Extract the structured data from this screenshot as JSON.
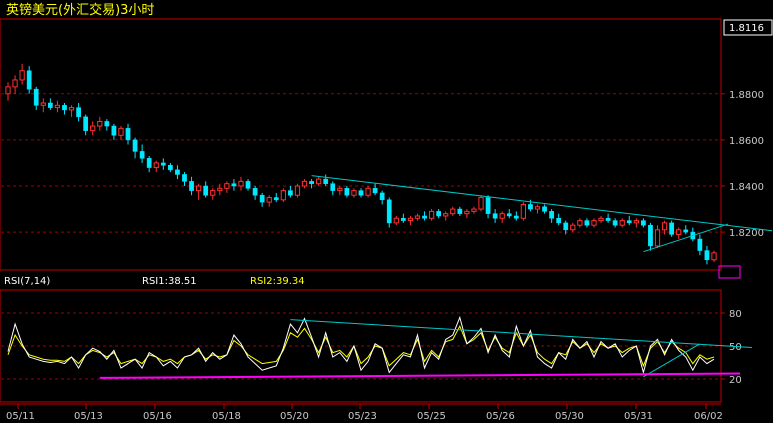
{
  "chart_data": [
    {
      "type": "candlestick",
      "title": "英镑美元(外汇交易)3小时",
      "last_price": "1.8116",
      "ylim": [
        1.804,
        1.912
      ],
      "y_ticks": [
        1.82,
        1.84,
        1.86,
        1.88
      ],
      "y_tick_labels": [
        "1.8200",
        "1.8400",
        "1.8600",
        "1.8800"
      ],
      "x_ticks": [
        "05/11",
        "05/13",
        "05/16",
        "05/18",
        "05/20",
        "05/23",
        "05/25",
        "05/26",
        "05/30",
        "05/31",
        "06/02"
      ],
      "grid": true,
      "ohlc": [
        [
          1.88,
          1.885,
          1.877,
          1.883
        ],
        [
          1.883,
          1.888,
          1.88,
          1.886
        ],
        [
          1.886,
          1.893,
          1.884,
          1.89
        ],
        [
          1.89,
          1.892,
          1.88,
          1.882
        ],
        [
          1.882,
          1.883,
          1.873,
          1.875
        ],
        [
          1.875,
          1.878,
          1.872,
          1.876
        ],
        [
          1.876,
          1.878,
          1.873,
          1.874
        ],
        [
          1.874,
          1.877,
          1.872,
          1.875
        ],
        [
          1.875,
          1.876,
          1.871,
          1.873
        ],
        [
          1.873,
          1.875,
          1.87,
          1.874
        ],
        [
          1.874,
          1.876,
          1.868,
          1.87
        ],
        [
          1.87,
          1.871,
          1.862,
          1.864
        ],
        [
          1.864,
          1.868,
          1.862,
          1.866
        ],
        [
          1.866,
          1.87,
          1.864,
          1.868
        ],
        [
          1.868,
          1.869,
          1.864,
          1.866
        ],
        [
          1.866,
          1.867,
          1.86,
          1.862
        ],
        [
          1.862,
          1.866,
          1.86,
          1.865
        ],
        [
          1.865,
          1.867,
          1.858,
          1.86
        ],
        [
          1.86,
          1.861,
          1.852,
          1.855
        ],
        [
          1.855,
          1.858,
          1.85,
          1.852
        ],
        [
          1.852,
          1.853,
          1.846,
          1.848
        ],
        [
          1.848,
          1.851,
          1.846,
          1.85
        ],
        [
          1.85,
          1.852,
          1.847,
          1.849
        ],
        [
          1.849,
          1.85,
          1.846,
          1.847
        ],
        [
          1.847,
          1.849,
          1.843,
          1.845
        ],
        [
          1.845,
          1.846,
          1.84,
          1.842
        ],
        [
          1.842,
          1.844,
          1.836,
          1.838
        ],
        [
          1.838,
          1.841,
          1.834,
          1.84
        ],
        [
          1.84,
          1.842,
          1.835,
          1.836
        ],
        [
          1.836,
          1.839,
          1.834,
          1.838
        ],
        [
          1.838,
          1.841,
          1.836,
          1.839
        ],
        [
          1.839,
          1.842,
          1.837,
          1.841
        ],
        [
          1.841,
          1.843,
          1.838,
          1.84
        ],
        [
          1.84,
          1.844,
          1.838,
          1.842
        ],
        [
          1.842,
          1.843,
          1.838,
          1.839
        ],
        [
          1.839,
          1.84,
          1.834,
          1.836
        ],
        [
          1.836,
          1.837,
          1.831,
          1.833
        ],
        [
          1.833,
          1.836,
          1.831,
          1.835
        ],
        [
          1.835,
          1.837,
          1.833,
          1.834
        ],
        [
          1.834,
          1.839,
          1.833,
          1.838
        ],
        [
          1.838,
          1.84,
          1.835,
          1.836
        ],
        [
          1.836,
          1.841,
          1.835,
          1.84
        ],
        [
          1.84,
          1.843,
          1.839,
          1.842
        ],
        [
          1.842,
          1.843,
          1.839,
          1.841
        ],
        [
          1.841,
          1.844,
          1.84,
          1.843
        ],
        [
          1.843,
          1.845,
          1.84,
          1.841
        ],
        [
          1.841,
          1.842,
          1.836,
          1.838
        ],
        [
          1.838,
          1.84,
          1.836,
          1.839
        ],
        [
          1.839,
          1.84,
          1.835,
          1.836
        ],
        [
          1.836,
          1.839,
          1.835,
          1.838
        ],
        [
          1.838,
          1.839,
          1.835,
          1.836
        ],
        [
          1.836,
          1.84,
          1.835,
          1.839
        ],
        [
          1.839,
          1.841,
          1.836,
          1.837
        ],
        [
          1.837,
          1.838,
          1.832,
          1.834
        ],
        [
          1.834,
          1.835,
          1.822,
          1.824
        ],
        [
          1.824,
          1.827,
          1.823,
          1.826
        ],
        [
          1.826,
          1.828,
          1.824,
          1.825
        ],
        [
          1.825,
          1.827,
          1.823,
          1.826
        ],
        [
          1.826,
          1.828,
          1.825,
          1.827
        ],
        [
          1.827,
          1.829,
          1.825,
          1.826
        ],
        [
          1.826,
          1.83,
          1.825,
          1.829
        ],
        [
          1.829,
          1.83,
          1.826,
          1.827
        ],
        [
          1.827,
          1.829,
          1.825,
          1.828
        ],
        [
          1.828,
          1.831,
          1.827,
          1.83
        ],
        [
          1.83,
          1.831,
          1.827,
          1.828
        ],
        [
          1.828,
          1.83,
          1.826,
          1.829
        ],
        [
          1.829,
          1.831,
          1.828,
          1.83
        ],
        [
          1.83,
          1.836,
          1.829,
          1.835
        ],
        [
          1.835,
          1.836,
          1.826,
          1.828
        ],
        [
          1.828,
          1.83,
          1.824,
          1.826
        ],
        [
          1.826,
          1.829,
          1.824,
          1.828
        ],
        [
          1.828,
          1.83,
          1.826,
          1.827
        ],
        [
          1.827,
          1.829,
          1.825,
          1.826
        ],
        [
          1.826,
          1.833,
          1.825,
          1.832
        ],
        [
          1.832,
          1.834,
          1.829,
          1.83
        ],
        [
          1.83,
          1.832,
          1.828,
          1.831
        ],
        [
          1.831,
          1.832,
          1.828,
          1.829
        ],
        [
          1.829,
          1.83,
          1.824,
          1.826
        ],
        [
          1.826,
          1.828,
          1.823,
          1.824
        ],
        [
          1.824,
          1.825,
          1.819,
          1.821
        ],
        [
          1.821,
          1.824,
          1.82,
          1.823
        ],
        [
          1.823,
          1.826,
          1.822,
          1.825
        ],
        [
          1.825,
          1.826,
          1.822,
          1.823
        ],
        [
          1.823,
          1.826,
          1.822,
          1.825
        ],
        [
          1.825,
          1.827,
          1.824,
          1.826
        ],
        [
          1.826,
          1.828,
          1.824,
          1.825
        ],
        [
          1.825,
          1.826,
          1.822,
          1.823
        ],
        [
          1.823,
          1.826,
          1.822,
          1.825
        ],
        [
          1.825,
          1.827,
          1.823,
          1.824
        ],
        [
          1.824,
          1.826,
          1.822,
          1.825
        ],
        [
          1.825,
          1.826,
          1.822,
          1.823
        ],
        [
          1.823,
          1.824,
          1.812,
          1.814
        ],
        [
          1.814,
          1.823,
          1.813,
          1.821
        ],
        [
          1.821,
          1.825,
          1.819,
          1.824
        ],
        [
          1.824,
          1.825,
          1.818,
          1.819
        ],
        [
          1.819,
          1.822,
          1.817,
          1.821
        ],
        [
          1.821,
          1.823,
          1.819,
          1.82
        ],
        [
          1.82,
          1.822,
          1.816,
          1.817
        ],
        [
          1.817,
          1.819,
          1.81,
          1.812
        ],
        [
          1.812,
          1.814,
          1.806,
          1.808
        ],
        [
          1.808,
          1.812,
          1.807,
          1.811
        ]
      ],
      "annotations": [
        {
          "type": "trendline",
          "color": "#00c8c8",
          "points": [
            [
              43,
              1.8445
            ],
            [
              103,
              1.8225
            ]
          ]
        },
        {
          "type": "trendline",
          "color": "#00c8c8",
          "points": [
            [
              90,
              1.8115
            ],
            [
              102,
              1.8235
            ]
          ]
        }
      ]
    },
    {
      "type": "line",
      "title": "RSI(7,14)",
      "ylim": [
        0,
        100
      ],
      "y_ticks": [
        20,
        50,
        80
      ],
      "y_tick_labels": [
        "20",
        "50",
        "80"
      ],
      "grid": true,
      "series": [
        {
          "name": "RSI1",
          "label_value": "38.51",
          "color": "#ffffff",
          "values": [
            45,
            70,
            52,
            40,
            38,
            36,
            35,
            36,
            34,
            40,
            30,
            42,
            48,
            45,
            38,
            46,
            30,
            34,
            38,
            30,
            44,
            40,
            32,
            36,
            30,
            40,
            42,
            48,
            36,
            44,
            38,
            42,
            60,
            52,
            40,
            34,
            28,
            30,
            32,
            48,
            70,
            62,
            75,
            58,
            40,
            62,
            40,
            44,
            36,
            50,
            28,
            36,
            52,
            48,
            26,
            34,
            42,
            40,
            60,
            30,
            44,
            38,
            56,
            60,
            76,
            52,
            58,
            66,
            44,
            60,
            46,
            40,
            68,
            50,
            64,
            40,
            34,
            30,
            44,
            38,
            56,
            48,
            54,
            40,
            54,
            48,
            52,
            40,
            46,
            50,
            26,
            50,
            56,
            42,
            56,
            46,
            40,
            28,
            40,
            34,
            38
          ]
        },
        {
          "name": "RSI2",
          "label_value": "39.34",
          "color": "#ffff00",
          "values": [
            42,
            60,
            50,
            42,
            40,
            38,
            37,
            37,
            36,
            40,
            34,
            42,
            46,
            44,
            40,
            44,
            34,
            36,
            38,
            34,
            42,
            40,
            36,
            38,
            34,
            40,
            42,
            46,
            38,
            42,
            40,
            42,
            55,
            50,
            42,
            38,
            34,
            35,
            36,
            46,
            62,
            58,
            66,
            56,
            44,
            58,
            44,
            46,
            40,
            50,
            34,
            40,
            50,
            48,
            32,
            38,
            44,
            42,
            56,
            36,
            46,
            40,
            54,
            56,
            68,
            52,
            56,
            62,
            46,
            58,
            48,
            44,
            62,
            50,
            60,
            44,
            38,
            34,
            44,
            42,
            54,
            48,
            52,
            44,
            52,
            48,
            50,
            44,
            48,
            50,
            32,
            48,
            54,
            44,
            54,
            48,
            44,
            34,
            42,
            38,
            40
          ]
        }
      ],
      "annotations": [
        {
          "type": "trendline",
          "color": "#00c8c8",
          "points": [
            [
              40,
              74
            ],
            [
              102,
              50
            ]
          ]
        },
        {
          "type": "trendline",
          "color": "#00c8c8",
          "points": [
            [
              90,
              22
            ],
            [
              98,
              52
            ]
          ]
        },
        {
          "type": "trendline",
          "color": "#ff00ff",
          "points": [
            [
              13,
              21
            ],
            [
              102,
              25
            ]
          ]
        }
      ]
    }
  ],
  "colors": {
    "up": "#ff3030",
    "down": "#00e8ff",
    "grid": "#a00000",
    "frame": "#c00000",
    "axis_text": "#c8c8c8",
    "title_text": "#ffff00",
    "rsi_label": "#ffffff"
  }
}
